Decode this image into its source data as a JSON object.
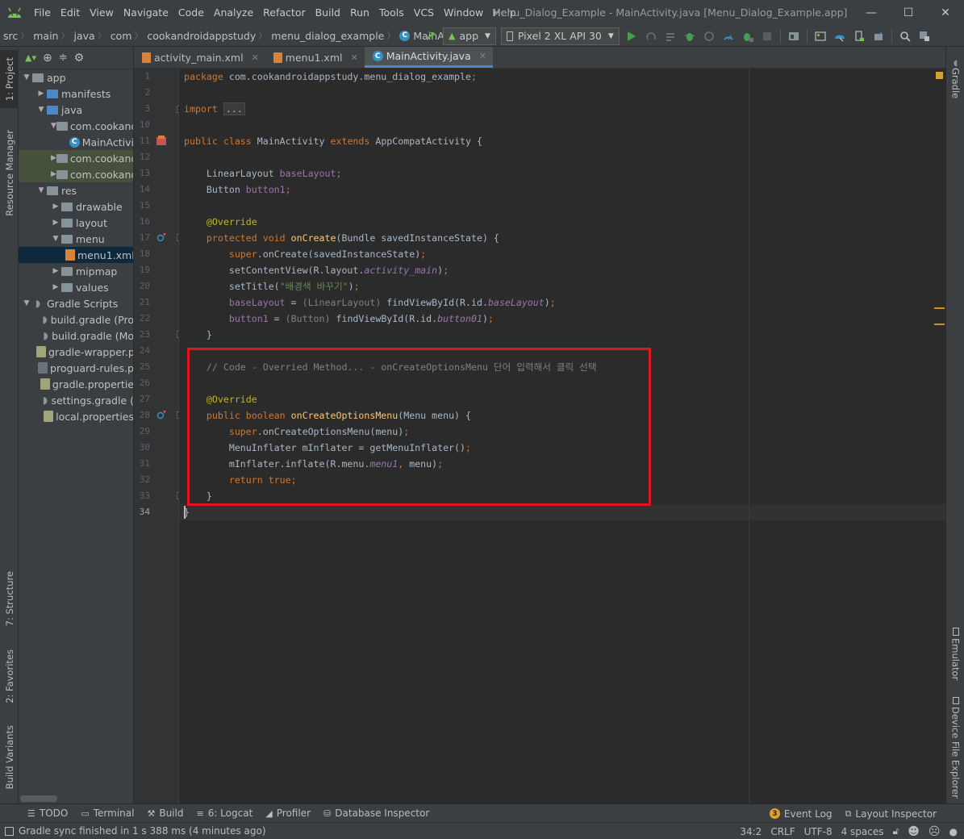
{
  "menu": [
    "File",
    "Edit",
    "View",
    "Navigate",
    "Code",
    "Analyze",
    "Refactor",
    "Build",
    "Run",
    "Tools",
    "VCS",
    "Window",
    "Help"
  ],
  "window_title": "Menu_Dialog_Example - MainActivity.java [Menu_Dialog_Example.app]",
  "window_controls": {
    "minimize": "—",
    "maximize": "☐",
    "close": "✕"
  },
  "breadcrumbs": [
    "src",
    "main",
    "java",
    "com",
    "cookandroidappstudy",
    "menu_dialog_example",
    "MainActivity"
  ],
  "toolbar": {
    "run_config": "app",
    "device": "Pixel 2 XL API 30"
  },
  "left_tabs": {
    "project": "1: Project",
    "resource_manager": "Resource Manager",
    "structure": "7: Structure",
    "favorites": "2: Favorites",
    "build_variants": "Build Variants"
  },
  "right_tabs": {
    "gradle": "Gradle",
    "emulator": "Emulator",
    "device_file_explorer": "Device File Explorer"
  },
  "project_tree": [
    {
      "label": "app",
      "depth": 0,
      "arrow": "▼",
      "icon": "module"
    },
    {
      "label": "manifests",
      "depth": 1,
      "arrow": "▶",
      "icon": "folder-blue"
    },
    {
      "label": "java",
      "depth": 1,
      "arrow": "▼",
      "icon": "folder-blue"
    },
    {
      "label": "com.cookandr",
      "depth": 2,
      "arrow": "▼",
      "icon": "package"
    },
    {
      "label": "MainActivi",
      "depth": 3,
      "arrow": "",
      "icon": "class"
    },
    {
      "label": "com.cookandr",
      "depth": 2,
      "arrow": "▶",
      "icon": "package"
    },
    {
      "label": "com.cookandr",
      "depth": 2,
      "arrow": "▶",
      "icon": "package"
    },
    {
      "label": "res",
      "depth": 1,
      "arrow": "▼",
      "icon": "folder-res"
    },
    {
      "label": "drawable",
      "depth": 2,
      "arrow": "▶",
      "icon": "folder"
    },
    {
      "label": "layout",
      "depth": 2,
      "arrow": "▶",
      "icon": "folder"
    },
    {
      "label": "menu",
      "depth": 2,
      "arrow": "▼",
      "icon": "folder"
    },
    {
      "label": "menu1.xml",
      "depth": 3,
      "arrow": "",
      "icon": "xml"
    },
    {
      "label": "mipmap",
      "depth": 2,
      "arrow": "▶",
      "icon": "folder"
    },
    {
      "label": "values",
      "depth": 2,
      "arrow": "▶",
      "icon": "folder"
    },
    {
      "label": "Gradle Scripts",
      "depth": 0,
      "arrow": "▼",
      "icon": "gradle"
    },
    {
      "label": "build.gradle (Pro",
      "depth": 1,
      "arrow": "",
      "icon": "gradle"
    },
    {
      "label": "build.gradle (Mo",
      "depth": 1,
      "arrow": "",
      "icon": "gradle"
    },
    {
      "label": "gradle-wrapper.p",
      "depth": 1,
      "arrow": "",
      "icon": "props"
    },
    {
      "label": "proguard-rules.p",
      "depth": 1,
      "arrow": "",
      "icon": "file"
    },
    {
      "label": "gradle.propertie",
      "depth": 1,
      "arrow": "",
      "icon": "props"
    },
    {
      "label": "settings.gradle (",
      "depth": 1,
      "arrow": "",
      "icon": "gradle"
    },
    {
      "label": "local.properties",
      "depth": 1,
      "arrow": "",
      "icon": "props"
    }
  ],
  "editor_tabs": [
    {
      "label": "activity_main.xml",
      "icon": "xml",
      "active": false
    },
    {
      "label": "menu1.xml",
      "icon": "xml",
      "active": false
    },
    {
      "label": "MainActivity.java",
      "icon": "class",
      "active": true
    }
  ],
  "line_numbers": [
    "1",
    "2",
    "3",
    "10",
    "11",
    "12",
    "13",
    "14",
    "15",
    "16",
    "17",
    "18",
    "19",
    "20",
    "21",
    "22",
    "23",
    "24",
    "25",
    "26",
    "27",
    "28",
    "29",
    "30",
    "31",
    "32",
    "33",
    "34"
  ],
  "code_lines": [
    [
      {
        "t": "package ",
        "c": "kw"
      },
      {
        "t": "com.cookandroidappstudy.menu_dialog_example",
        "c": ""
      },
      {
        "t": ";",
        "c": "kw"
      }
    ],
    [],
    [
      {
        "t": "import ",
        "c": "kw"
      },
      {
        "t": "...",
        "c": "fold-box"
      }
    ],
    [],
    [
      {
        "t": "public class ",
        "c": "kw"
      },
      {
        "t": "MainActivity ",
        "c": ""
      },
      {
        "t": "extends ",
        "c": "kw"
      },
      {
        "t": "AppCompatActivity {",
        "c": ""
      }
    ],
    [],
    [
      {
        "t": "    LinearLayout ",
        "c": ""
      },
      {
        "t": "baseLayout",
        "c": "fld"
      },
      {
        "t": ";",
        "c": "kw"
      }
    ],
    [
      {
        "t": "    Button ",
        "c": ""
      },
      {
        "t": "button1",
        "c": "fld"
      },
      {
        "t": ";",
        "c": "kw"
      }
    ],
    [],
    [
      {
        "t": "    @Override",
        "c": "ann"
      }
    ],
    [
      {
        "t": "    protected void ",
        "c": "kw"
      },
      {
        "t": "onCreate",
        "c": "mth"
      },
      {
        "t": "(Bundle savedInstanceState) {",
        "c": ""
      }
    ],
    [
      {
        "t": "        super",
        "c": "kw"
      },
      {
        "t": ".onCreate(savedInstanceState)",
        "c": ""
      },
      {
        "t": ";",
        "c": "kw"
      }
    ],
    [
      {
        "t": "        setContentView(R.layout.",
        "c": ""
      },
      {
        "t": "activity_main",
        "c": "ifld"
      },
      {
        "t": ")",
        "c": ""
      },
      {
        "t": ";",
        "c": "kw"
      }
    ],
    [
      {
        "t": "        setTitle(",
        "c": ""
      },
      {
        "t": "\"배경색 바꾸기\"",
        "c": "str"
      },
      {
        "t": ")",
        "c": ""
      },
      {
        "t": ";",
        "c": "kw"
      }
    ],
    [
      {
        "t": "        baseLayout",
        "c": "fld"
      },
      {
        "t": " = ",
        "c": ""
      },
      {
        "t": "(LinearLayout) ",
        "c": "cast"
      },
      {
        "t": "findViewById(R.id.",
        "c": ""
      },
      {
        "t": "baseLayout",
        "c": "ifld"
      },
      {
        "t": ")",
        "c": ""
      },
      {
        "t": ";",
        "c": "kw"
      }
    ],
    [
      {
        "t": "        button1",
        "c": "fld"
      },
      {
        "t": " = ",
        "c": ""
      },
      {
        "t": "(Button) ",
        "c": "cast"
      },
      {
        "t": "findViewById(R.id.",
        "c": ""
      },
      {
        "t": "button01",
        "c": "ifld"
      },
      {
        "t": ")",
        "c": ""
      },
      {
        "t": ";",
        "c": "kw"
      }
    ],
    [
      {
        "t": "    }",
        "c": ""
      }
    ],
    [],
    [
      {
        "t": "    // Code - Overried Method... - onCreateOptionsMenu 단어 입력해서 클릭 선택",
        "c": "cmt"
      }
    ],
    [],
    [
      {
        "t": "    @Override",
        "c": "ann"
      }
    ],
    [
      {
        "t": "    public boolean ",
        "c": "kw"
      },
      {
        "t": "onCreateOptionsMenu",
        "c": "mth"
      },
      {
        "t": "(Menu menu) {",
        "c": ""
      }
    ],
    [
      {
        "t": "        super",
        "c": "kw"
      },
      {
        "t": ".onCreateOptionsMenu(menu)",
        "c": ""
      },
      {
        "t": ";",
        "c": "kw"
      }
    ],
    [
      {
        "t": "        MenuInflater mInflater = getMenuInflater()",
        "c": ""
      },
      {
        "t": ";",
        "c": "kw"
      }
    ],
    [
      {
        "t": "        mInflater.inflate(R.menu.",
        "c": ""
      },
      {
        "t": "menu1",
        "c": "ifld"
      },
      {
        "t": ", ",
        "c": "kw"
      },
      {
        "t": "menu)",
        "c": ""
      },
      {
        "t": ";",
        "c": "kw"
      }
    ],
    [
      {
        "t": "        return true",
        "c": "kw"
      },
      {
        "t": ";",
        "c": "kw"
      }
    ],
    [
      {
        "t": "    }",
        "c": ""
      }
    ],
    [
      {
        "t": "}",
        "c": ""
      }
    ]
  ],
  "bottom_tools": [
    {
      "label": "TODO",
      "icon": "todo-icon"
    },
    {
      "label": "Terminal",
      "icon": "terminal-icon"
    },
    {
      "label": "Build",
      "icon": "hammer-icon"
    },
    {
      "label": "6: Logcat",
      "icon": "logcat-icon"
    },
    {
      "label": "Profiler",
      "icon": "profiler-icon"
    },
    {
      "label": "Database Inspector",
      "icon": "database-icon"
    }
  ],
  "bottom_right_tools": {
    "event_log": "Event Log",
    "event_count": "3",
    "layout_inspector": "Layout Inspector"
  },
  "status": {
    "message": "Gradle sync finished in 1 s 388 ms (4 minutes ago)",
    "position": "34:2",
    "line_sep": "CRLF",
    "encoding": "UTF-8",
    "indent": "4 spaces"
  },
  "colors": {
    "accent": "#4a88c7",
    "highlight_box": "#e0161d",
    "editor_bg": "#2b2b2b",
    "keyword": "#cc7832",
    "method": "#ffc66d",
    "field": "#9876aa",
    "string": "#6a8759"
  }
}
